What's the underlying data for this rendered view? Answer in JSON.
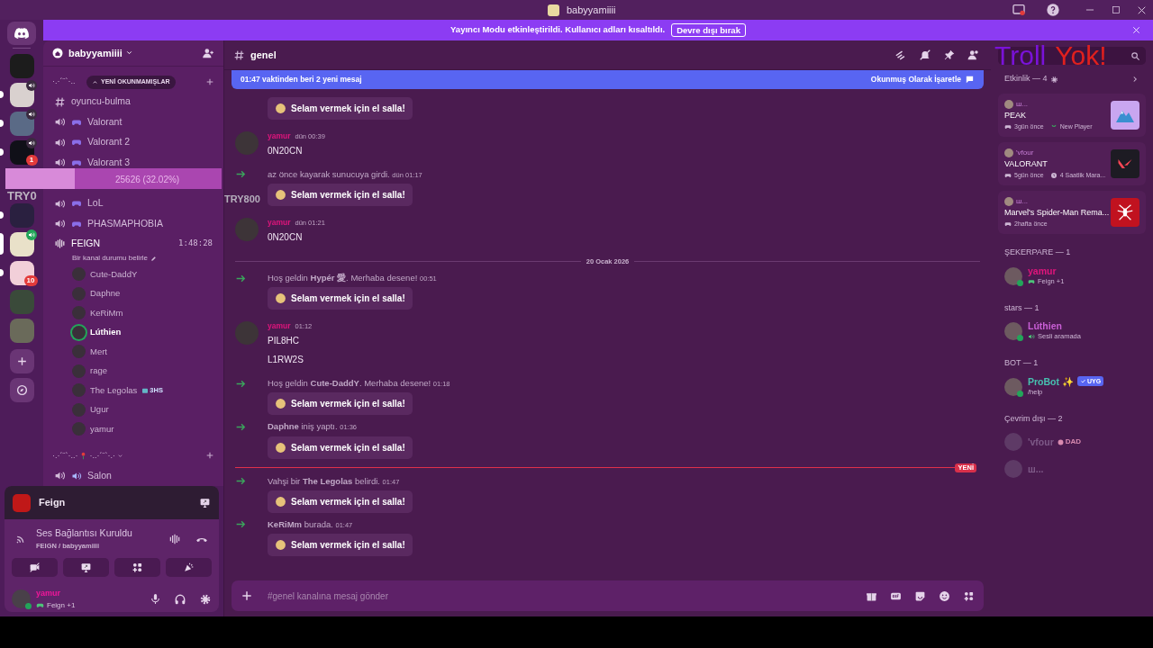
{
  "titlebar": {
    "title": "babyyamiiii"
  },
  "banner": {
    "text": "Yayıncı Modu etkinleştirildi. Kullanıcı adları kısaltıldı.",
    "button": "Devre dışı bırak"
  },
  "servers": [
    {
      "selected": false,
      "unread": false,
      "voice": false,
      "connected": false
    },
    {
      "selected": false,
      "unread": true,
      "voice": true,
      "connected": false
    },
    {
      "selected": false,
      "unread": true,
      "voice": true,
      "connected": false
    },
    {
      "selected": false,
      "unread": true,
      "voice": true,
      "connected": false,
      "badge": "1"
    },
    {
      "selected": false,
      "unread": true,
      "voice": false,
      "connected": false
    },
    {
      "selected": true,
      "unread": false,
      "voice": true,
      "connected": true
    },
    {
      "selected": false,
      "unread": true,
      "voice": false,
      "connected": false,
      "badge": "10"
    },
    {
      "selected": false,
      "unread": false,
      "voice": false,
      "connected": false
    },
    {
      "selected": false,
      "unread": false,
      "voice": false,
      "connected": false
    }
  ],
  "server_header": {
    "name": "babyyamiiii"
  },
  "unread_pill": "YENİ OKUNMAMIŞLAR",
  "channels": [
    {
      "kind": "category",
      "parts": [
        "·.·´¨`·.."
      ]
    },
    {
      "kind": "text",
      "name": "oyuncu-bulma"
    },
    {
      "kind": "game_voice",
      "name": "Valorant"
    },
    {
      "kind": "game_voice",
      "name": "Valorant 2"
    },
    {
      "kind": "game_voice",
      "name": "Valorant 3"
    },
    {
      "kind": "spacer"
    },
    {
      "kind": "game_voice",
      "name": "LoL"
    },
    {
      "kind": "game_voice",
      "name": "PHASMAPHOBIA"
    },
    {
      "kind": "live",
      "name": "FEIGN",
      "timer": "1:48:28",
      "status": "Bir kanal durumu belirle",
      "members": [
        {
          "name": "Cute-DaddY",
          "speaking": false
        },
        {
          "name": "Daphne",
          "speaking": false
        },
        {
          "name": "KeRiMm",
          "speaking": false
        },
        {
          "name": "Lúthien",
          "speaking": true
        },
        {
          "name": "Mert",
          "speaking": false
        },
        {
          "name": "rage",
          "speaking": false
        },
        {
          "name": "The Legolas",
          "speaking": false,
          "tag": "3HS"
        },
        {
          "name": "Ugur",
          "speaking": false
        },
        {
          "name": "yamur",
          "speaking": false
        }
      ]
    },
    {
      "kind": "category",
      "parts": [
        "·.·´¨`·..·",
        "·..·´¨`·.·"
      ]
    },
    {
      "kind": "voice",
      "name": "Salon"
    }
  ],
  "voice_panel": {
    "stream": "Feign",
    "connection": "Ses Bağlantısı Kuruldu",
    "channel": "FEIGN / babyyamiiii"
  },
  "user_panel": {
    "name": "yamur",
    "activity": "Feign +1",
    "online": true
  },
  "chat": {
    "channel": "genel",
    "new_bar": {
      "text": "01:47 vaktinden beri 2 yeni mesaj",
      "action": "Okunmuş Olarak İşaretle"
    },
    "messages": [
      {
        "kind": "wave",
        "button": "Selam vermek için el salla!"
      },
      {
        "kind": "user",
        "author": "yamur",
        "time": "dün 00:39",
        "lines": [
          "0N20CN"
        ]
      },
      {
        "kind": "system",
        "text": "az önce kayarak sunucuya girdi.",
        "time": "dün 01:17",
        "button": "Selam vermek için el salla!"
      },
      {
        "kind": "user",
        "author": "yamur",
        "time": "dün 01:21",
        "lines": [
          "0N20CN"
        ]
      },
      {
        "kind": "date",
        "text": "20 Ocak 2026"
      },
      {
        "kind": "system",
        "text": "Hoş geldin **Hypér 愛**. Merhaba desene!",
        "time": "00:51",
        "button": "Selam vermek için el salla!"
      },
      {
        "kind": "user",
        "author": "yamur",
        "time": "01:12",
        "lines": [
          "PIL8HC",
          "L1RW2S"
        ]
      },
      {
        "kind": "system",
        "text": "Hoş geldin **Cute-DaddY**. Merhaba desene!",
        "time": "01:18",
        "button": "Selam vermek için el salla!"
      },
      {
        "kind": "system",
        "text": "**Daphne** iniş yaptı.",
        "time": "01:36",
        "button": "Selam vermek için el salla!"
      },
      {
        "kind": "new",
        "text": "YENİ"
      },
      {
        "kind": "system",
        "text": "Vahşi bir **The Legolas** belirdi.",
        "time": "01:47",
        "button": "Selam vermek için el salla!"
      },
      {
        "kind": "system",
        "text": "**KeRiMm** burada.",
        "time": "01:47",
        "button": "Selam vermek için el salla!"
      }
    ],
    "input": {
      "placeholder": "#genel kanalına mesaj gönder"
    }
  },
  "activity": {
    "label": "Etkinlik — 4",
    "cards": [
      {
        "user": "ш...",
        "title": "PEAK",
        "time": "3gün önce",
        "extra": "New Player",
        "kind": "peak"
      },
      {
        "user": "'vfour",
        "title": "VALORANT",
        "time": "5gün önce",
        "extra": "4 Saatlik Mara...",
        "kind": "valorant"
      },
      {
        "user": "ш...",
        "title": "Marvel's Spider-Man Rema...",
        "time": "2hafta önce",
        "kind": "spider"
      }
    ]
  },
  "groups": [
    {
      "label": "ŞEKERPARE — 1",
      "members": [
        {
          "name": "yamur",
          "color": "#e0157c",
          "online": true,
          "status": "Feign +1",
          "kind": "playing"
        }
      ]
    },
    {
      "label": "stars — 1",
      "members": [
        {
          "name": "Lúthien",
          "color": "#c95fd6",
          "online": true,
          "status": "Sesli aramada",
          "kind": "in_voice"
        }
      ]
    },
    {
      "label": "BOT — 1",
      "members": [
        {
          "name": "ProBot ✨",
          "color": "#47c1b0",
          "online": true,
          "status": "/help",
          "tag": "UYG",
          "kind": "bot"
        }
      ]
    },
    {
      "label": "Çevrim dışı — 2",
      "members": [
        {
          "name": "'vfour",
          "color": "#7e5a88",
          "online": false,
          "tag2": "DAD"
        },
        {
          "name": "ш...",
          "color": "#7e5a88",
          "online": false
        }
      ]
    }
  ],
  "stream_overlay": {
    "progress": {
      "level": 0.3202,
      "text": "25626 (32.02%)"
    },
    "labels": [
      "TRY0",
      "TRY800"
    ],
    "title_parts": [
      "Troll",
      "Yok!"
    ]
  }
}
